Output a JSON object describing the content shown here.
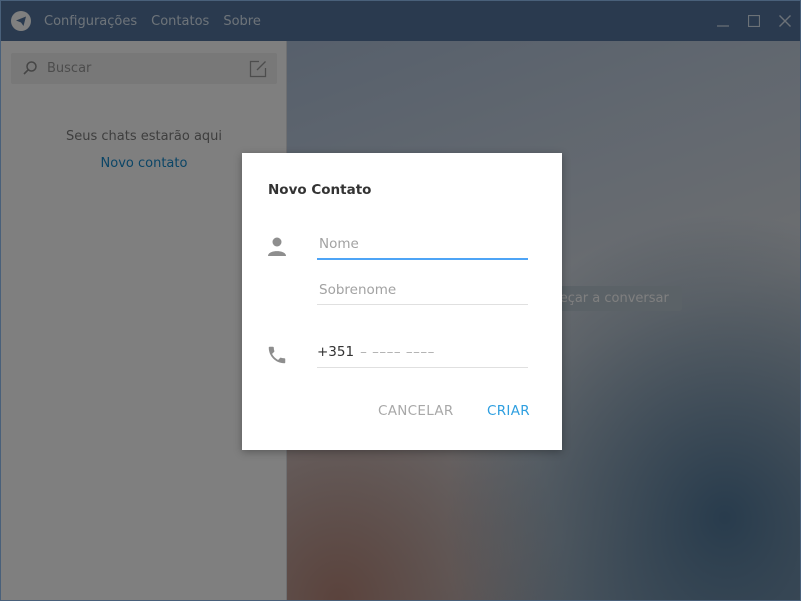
{
  "titlebar": {
    "menu": [
      "Configurações",
      "Contatos",
      "Sobre"
    ],
    "accent": "#54759e"
  },
  "sidebar": {
    "search_placeholder": "Buscar",
    "empty_text": "Seus chats estarão aqui",
    "new_contact_link": "Novo contato"
  },
  "main": {
    "start_chat_text": "Começar a conversar"
  },
  "dialog": {
    "title": "Novo Contato",
    "first_name_placeholder": "Nome",
    "last_name_placeholder": "Sobrenome",
    "phone_code": "+351",
    "phone_placeholder": "– –––– ––––",
    "cancel_label": "CANCELAR",
    "create_label": "CRIAR",
    "accent_color": "#2f9fe0"
  },
  "icons": {
    "app": "telegram-icon",
    "minimize": "minimize-icon",
    "maximize": "maximize-icon",
    "close": "close-icon",
    "search": "search-icon",
    "compose": "compose-icon",
    "person": "person-icon",
    "phone": "phone-icon"
  }
}
